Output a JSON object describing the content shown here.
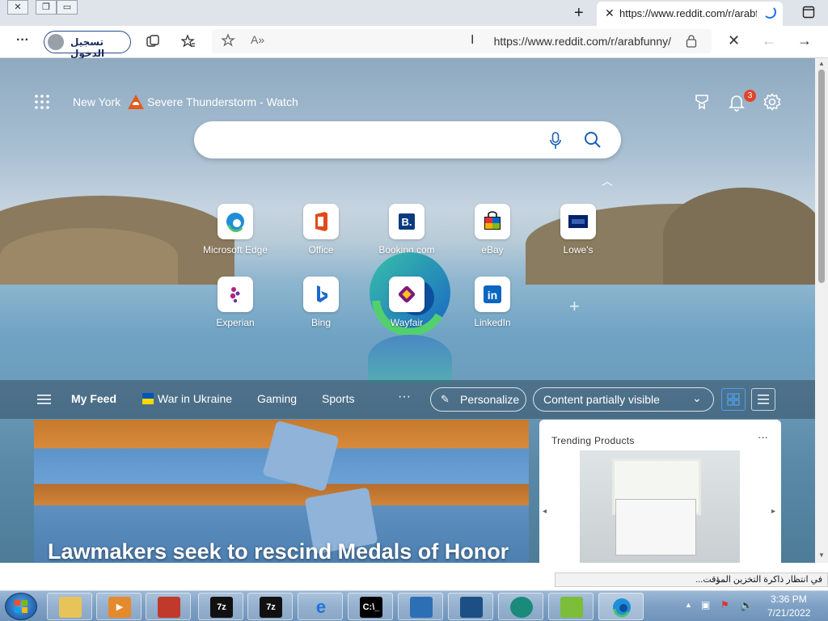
{
  "browser": {
    "tab_title": "https://www.reddit.com/r/arabfu",
    "address_url": "https://www.reddit.com/r/arabfunny/",
    "signin_label": "تسجيل الدخول",
    "new_tab_symbol": "+",
    "more_symbol": "···"
  },
  "newtab": {
    "location": "New York",
    "weather": "Severe Thunderstorm - Watch",
    "notification_count": "3",
    "quick_links": [
      {
        "name": "Microsoft Edge"
      },
      {
        "name": "Office"
      },
      {
        "name": "Booking.com"
      },
      {
        "name": "eBay"
      },
      {
        "name": "Lowe's"
      },
      {
        "name": "Experian"
      },
      {
        "name": "Bing"
      },
      {
        "name": "Wayfair"
      },
      {
        "name": "LinkedIn"
      }
    ],
    "feed_tabs": [
      "My Feed",
      "War in Ukraine",
      "Gaming",
      "Sports"
    ],
    "personalize_label": "Personalize",
    "content_visibility": "Content partially visible",
    "hero_headline": "Lawmakers seek to rescind Medals of Honor",
    "trending_title": "Trending Products"
  },
  "notification": {
    "text": "في انتظار ذاكرة التخزين المؤقت..."
  },
  "taskbar": {
    "time": "3:36 PM",
    "date": "7/21/2022",
    "apps": [
      {
        "icon": "explorer-icon",
        "label": ""
      },
      {
        "icon": "media-player-icon",
        "label": ""
      },
      {
        "icon": "parallels-icon",
        "label": ""
      },
      {
        "icon": "7zip-icon",
        "label": "7z"
      },
      {
        "icon": "7zip-icon",
        "label": "7z"
      },
      {
        "icon": "ie-icon",
        "label": ""
      },
      {
        "icon": "cmd-icon",
        "label": "C:\\_"
      },
      {
        "icon": "network-icon",
        "label": ""
      },
      {
        "icon": "installer-icon",
        "label": ""
      },
      {
        "icon": "app-icon",
        "label": ""
      },
      {
        "icon": "notepad-icon",
        "label": ""
      },
      {
        "icon": "edge-icon",
        "label": ""
      }
    ]
  }
}
